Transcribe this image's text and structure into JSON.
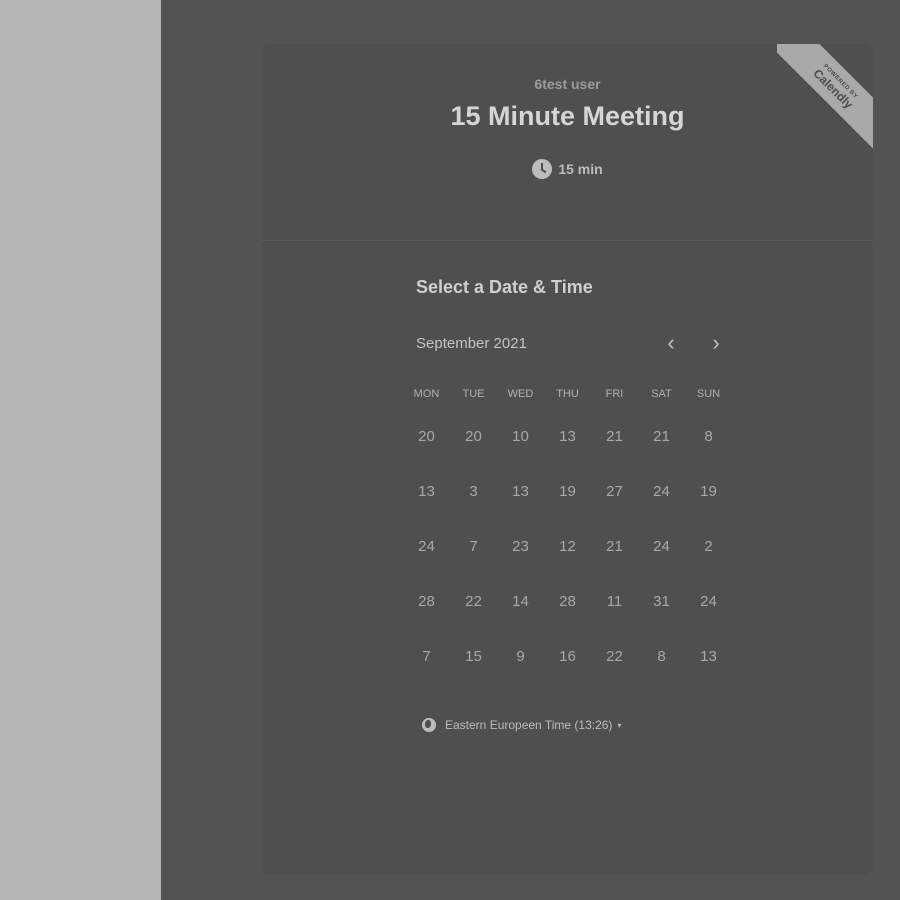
{
  "header": {
    "user_name": "6test user",
    "event_title": "15 Minute Meeting",
    "duration": "15 min",
    "duration_icon": "clock-icon",
    "ribbon_powered_by": "POWERED BY",
    "ribbon_brand": "Calendly"
  },
  "scheduler": {
    "title": "Select a Date & Time",
    "month": "September 2021",
    "prev_icon": "chevron-left-icon",
    "next_icon": "chevron-right-icon",
    "prev_glyph": "‹",
    "next_glyph": "›",
    "weekdays": [
      "MON",
      "TUE",
      "WED",
      "THU",
      "FRI",
      "SAT",
      "SUN"
    ],
    "weeks": [
      [
        "20",
        "20",
        "10",
        "13",
        "21",
        "21",
        "8"
      ],
      [
        "13",
        "3",
        "13",
        "19",
        "27",
        "24",
        "19"
      ],
      [
        "24",
        "7",
        "23",
        "12",
        "21",
        "24",
        "2"
      ],
      [
        "28",
        "22",
        "14",
        "28",
        "11",
        "31",
        "24"
      ],
      [
        "7",
        "15",
        "9",
        "16",
        "22",
        "8",
        "13"
      ]
    ]
  },
  "timezone": {
    "label": "Eastern Europeen Time (13:26)",
    "icon": "globe-icon",
    "caret": "▾"
  },
  "colors": {
    "overlay": "#535353",
    "left_panel": "#b5b5b5",
    "card": "#4f4f4f"
  }
}
